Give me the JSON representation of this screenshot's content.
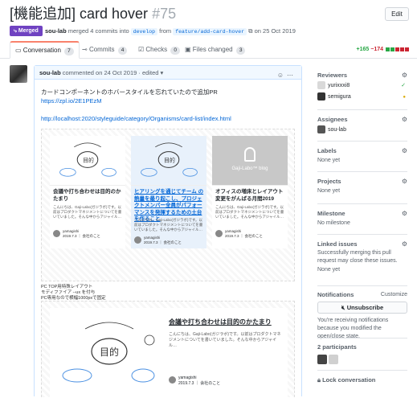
{
  "header": {
    "title": "[機能追加] card hover",
    "number": "#75",
    "edit_label": "Edit"
  },
  "status": {
    "badge": "Merged",
    "author": "sou-lab",
    "merged_text": "merged 4 commits into",
    "base_branch": "develop",
    "from_text": "from",
    "head_branch": "feature/add-card-hover",
    "date_text": "on 25 Oct 2019"
  },
  "tabs": [
    {
      "label": "Conversation",
      "count": "7"
    },
    {
      "label": "Commits",
      "count": "4"
    },
    {
      "label": "Checks",
      "count": "0"
    },
    {
      "label": "Files changed",
      "count": "3"
    }
  ],
  "diffstat": {
    "additions": "+165",
    "deletions": "−174"
  },
  "comment": {
    "author": "sou-lab",
    "meta": "commented on 24 Oct 2019 · edited",
    "line1": "カードコンポーネントのホバースタイルを忘れていたので追加PR",
    "link1": "https://zpl.io/2E1PEzM",
    "link2": "http://localhost:2020/styleguide/category/Organisms/card-list/index.html"
  },
  "cards": [
    {
      "title": "会議や打ち合わせは目的のかたまり",
      "body": "こんにちは、Gaji-Labo(ガジラボ)です。以前はプロダクトマネジメントについてを書いていました。そんな中からアジャイル…",
      "author": "yamagishi",
      "date": "2019.7.3 ｜ 会社のこと"
    },
    {
      "title": "ヒアリングを通じてチーム の熱量を最り起こし、プロジェクトメンバー全員がパフォーマンスを発揮するための土台を作ること",
      "body": "こんにちは、Gaji-Labo(ガジラボ)です。以前はプロダクトマネジメントについてを書いていました。そんな中からアジャイル…",
      "author": "yamagishi",
      "date": "2019.7.3 ｜ 会社のこと"
    },
    {
      "title": "オフィスの増床とレイアウト変更をがんばる月間2019",
      "body": "こんにちは、Gaji-Labo(ガジラボ)です。以前はプロダクトマネジメントについてを書いていました。そんな中からアジャイル…",
      "author": "yamagishi",
      "date": "2019.7.3 ｜ 会社のこと",
      "logo": "Gaji-Labo™ blog"
    }
  ],
  "pc_note": [
    "PC TOP用特殊レイアウト",
    "モディファイア --ux を付与",
    "PC専用なので横幅1000pxで固定"
  ],
  "wide_card": {
    "title": "会議や打ち合わせは目的のかたまり",
    "body": "こんにちは、Gaji-Labo(ガジラボ)です。以前はプロダクトマネジメントについてを書いていました。そんな中からアジャイル…",
    "author": "yamagishi",
    "date": "2019.7.3 ｜ 会社のこと"
  },
  "sidebar": {
    "reviewers_h": "Reviewers",
    "reviewers": [
      {
        "name": "yurixxxi8",
        "status": "✓",
        "color": "#28a745"
      },
      {
        "name": "semigura",
        "status": "●",
        "color": "#dbab09"
      }
    ],
    "assignees_h": "Assignees",
    "assignee": "sou-lab",
    "labels_h": "Labels",
    "labels_v": "None yet",
    "projects_h": "Projects",
    "projects_v": "None yet",
    "milestone_h": "Milestone",
    "milestone_v": "No milestone",
    "linked_h": "Linked issues",
    "linked_v": "Successfully merging this pull request may close these issues.",
    "linked_v2": "None yet",
    "notif_h": "Notifications",
    "notif_customize": "Customize",
    "unsubscribe": "Unsubscribe",
    "notif_note": "You're receiving notifications because you modified the open/close state.",
    "participants_h": "2 participants",
    "lock": "Lock conversation"
  },
  "colors": {
    "merged": "#6f42c1",
    "link": "#0366d6",
    "tab_accent": "#f9826c"
  }
}
